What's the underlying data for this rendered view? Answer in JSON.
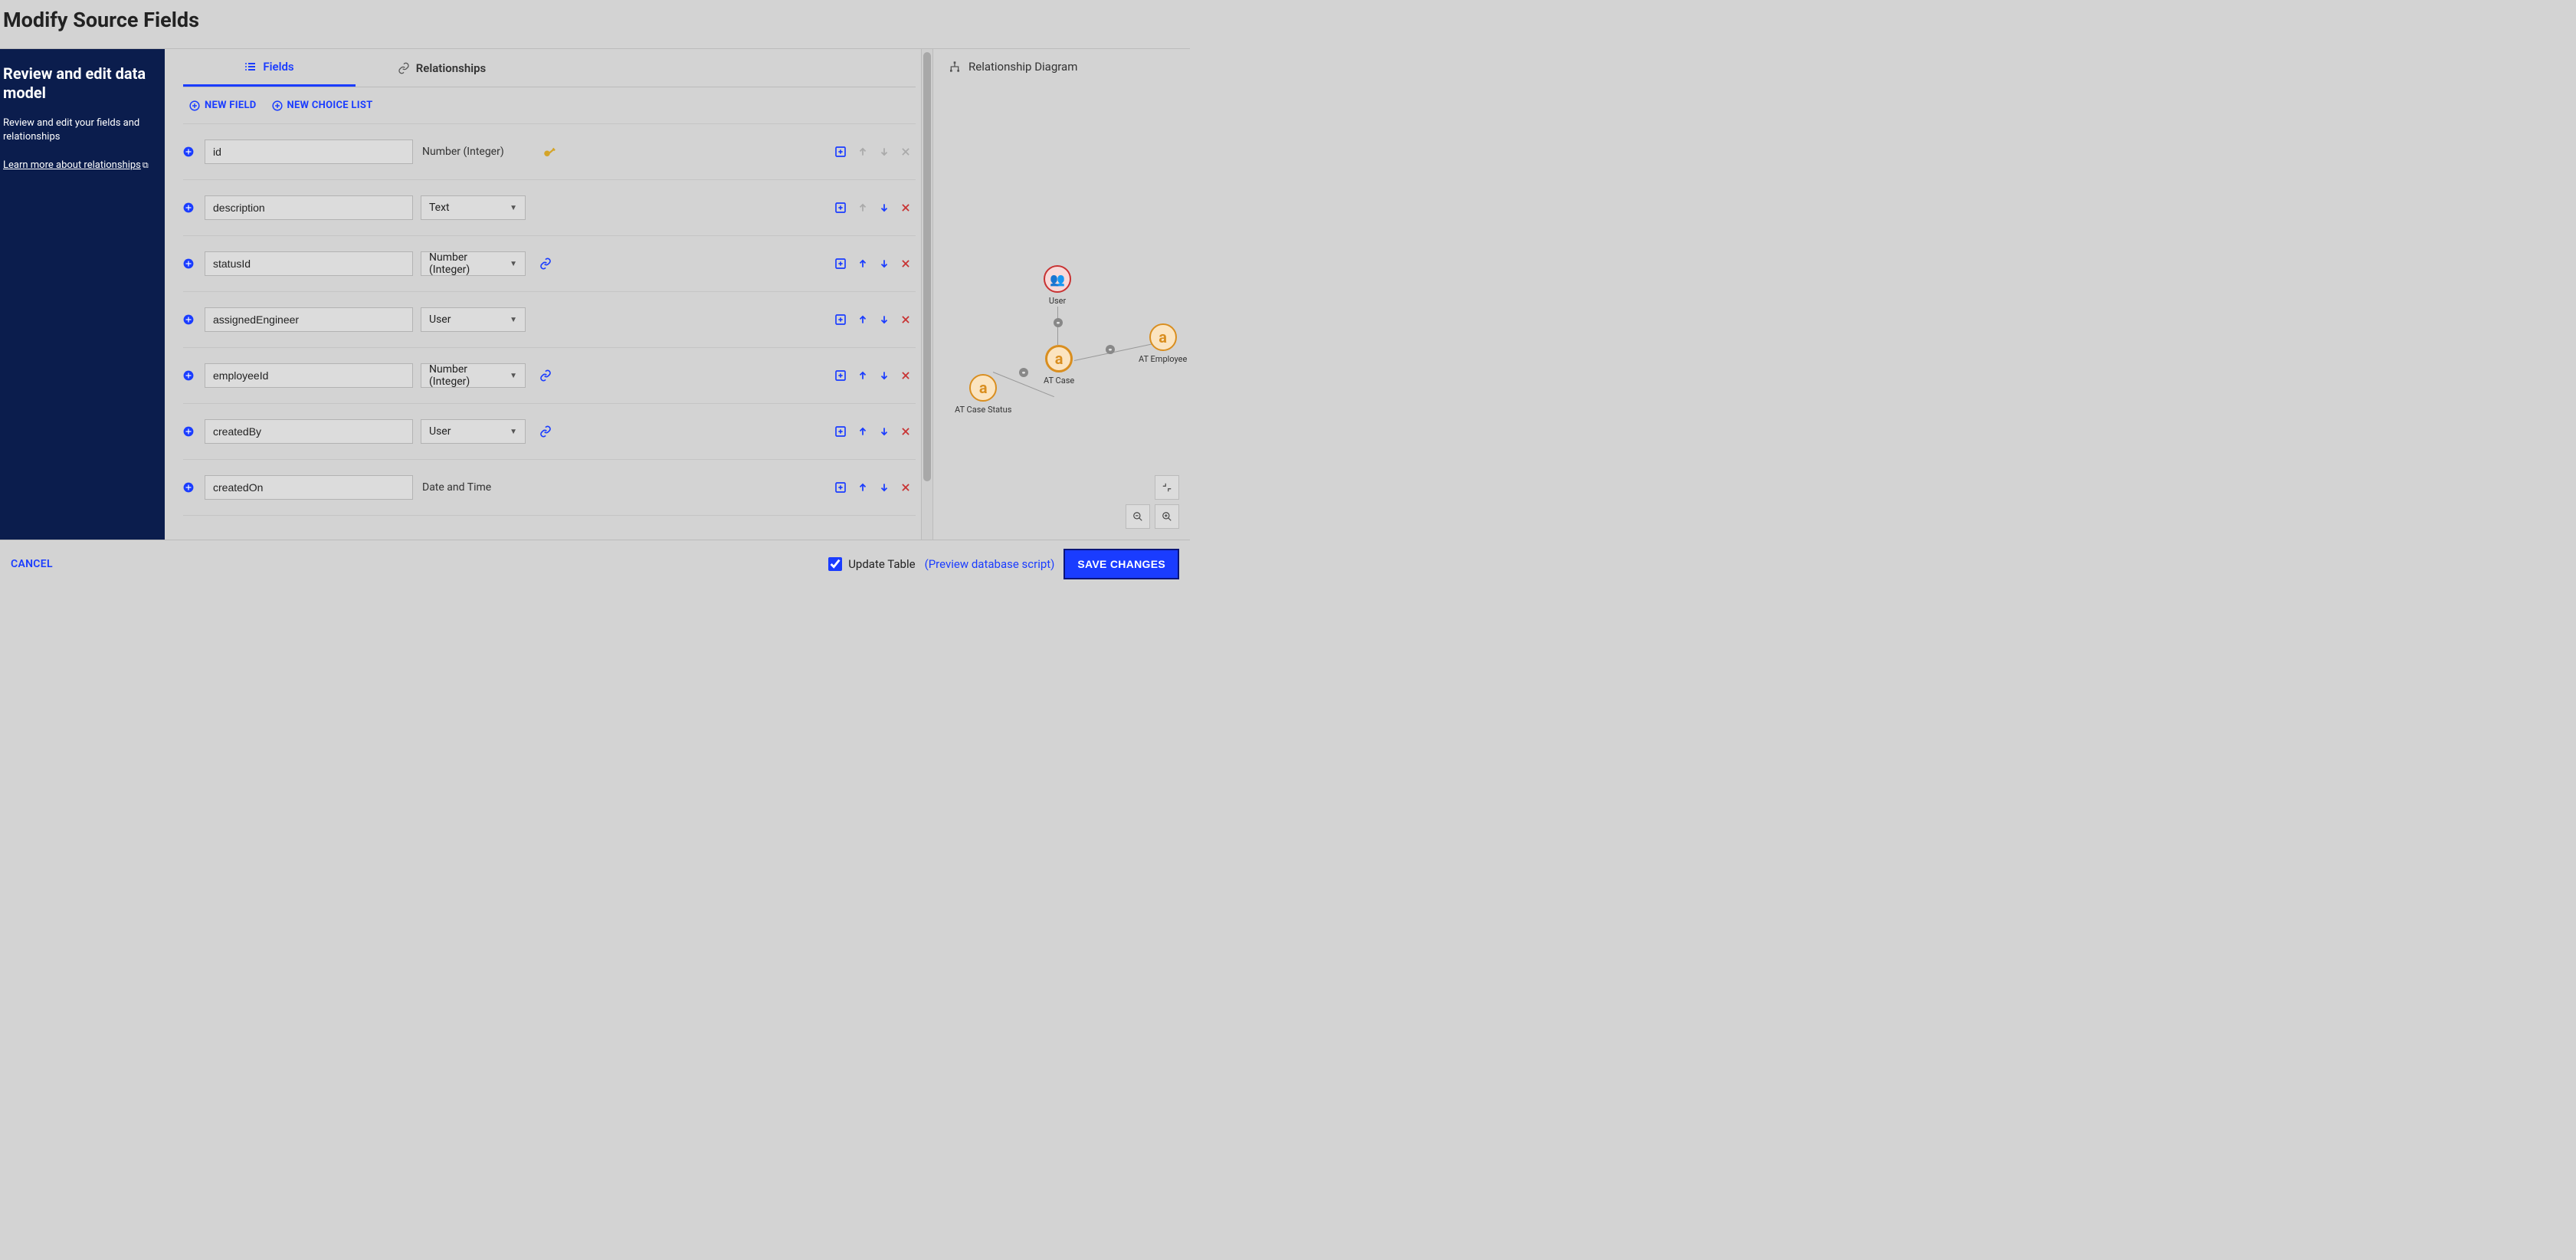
{
  "title": "Modify Source Fields",
  "sidebar": {
    "heading": "Review and edit data model",
    "subtext": "Review and edit your fields and relationships",
    "link_text": "Learn more about relationships"
  },
  "tabs": {
    "fields": "Fields",
    "relationships": "Relationships"
  },
  "toolbar": {
    "new_field": "NEW FIELD",
    "new_choice_list": "NEW CHOICE LIST"
  },
  "fields": [
    {
      "name": "id",
      "type": "Number (Integer)",
      "type_editable": false,
      "key": true,
      "link": false,
      "upEnabled": false,
      "downEnabled": false,
      "delEnabled": false
    },
    {
      "name": "description",
      "type": "Text",
      "type_editable": true,
      "key": false,
      "link": false,
      "upEnabled": false,
      "downEnabled": true,
      "delEnabled": true
    },
    {
      "name": "statusId",
      "type": "Number (Integer)",
      "type_editable": true,
      "key": false,
      "link": true,
      "upEnabled": true,
      "downEnabled": true,
      "delEnabled": true
    },
    {
      "name": "assignedEngineer",
      "type": "User",
      "type_editable": true,
      "key": false,
      "link": false,
      "upEnabled": true,
      "downEnabled": true,
      "delEnabled": true
    },
    {
      "name": "employeeId",
      "type": "Number (Integer)",
      "type_editable": true,
      "key": false,
      "link": true,
      "upEnabled": true,
      "downEnabled": true,
      "delEnabled": true
    },
    {
      "name": "createdBy",
      "type": "User",
      "type_editable": true,
      "key": false,
      "link": true,
      "upEnabled": true,
      "downEnabled": true,
      "delEnabled": true
    },
    {
      "name": "createdOn",
      "type": "Date and Time",
      "type_editable": false,
      "key": false,
      "link": false,
      "upEnabled": true,
      "downEnabled": true,
      "delEnabled": true
    }
  ],
  "right_panel": {
    "title": "Relationship Diagram",
    "nodes": {
      "user": "User",
      "case": "AT Case",
      "status": "AT Case Status",
      "employee": "AT Employee"
    }
  },
  "footer": {
    "cancel": "CANCEL",
    "update_table": "Update Table",
    "preview": "(Preview database script)",
    "save": "SAVE CHANGES"
  }
}
